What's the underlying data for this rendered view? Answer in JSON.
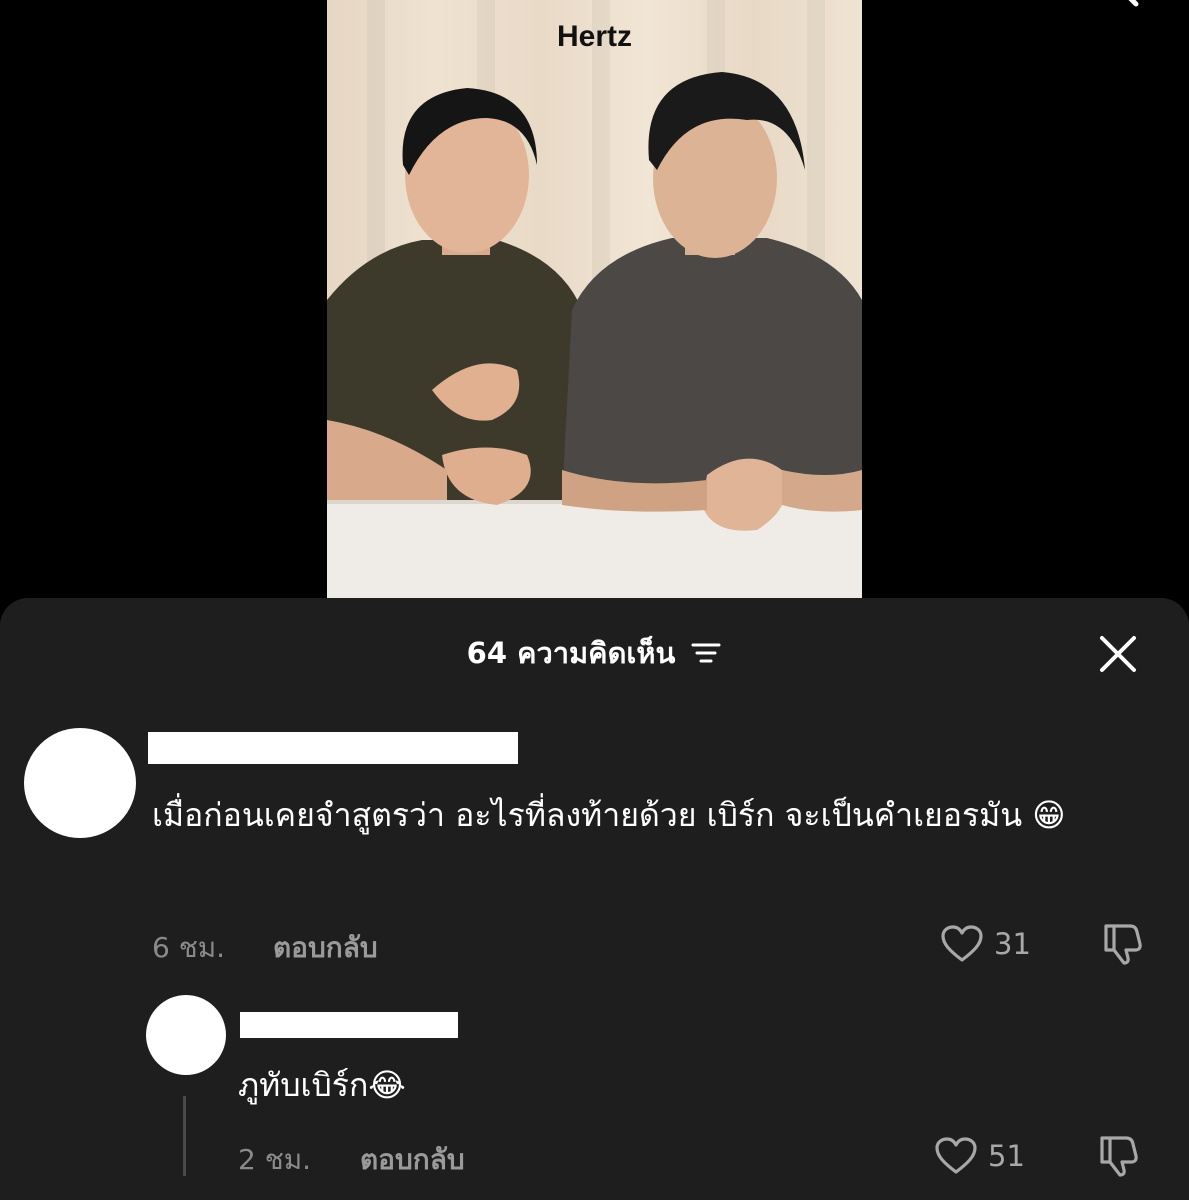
{
  "video": {
    "brand": "Hertz",
    "icons": {
      "search": "search-icon"
    }
  },
  "comments_sheet": {
    "count_label": "64 ความคิดเห็น",
    "icons": {
      "sort": "sort-icon",
      "close": "close-icon",
      "like": "heart-icon",
      "dislike": "thumbs-down-icon"
    },
    "comments": [
      {
        "text": "เมื่อก่อนเคยจำสูตรว่า อะไรที่ลงท้ายด้วย เบิร์ก จะเป็นคำเยอรมัน 😁",
        "time": "6 ชม.",
        "reply_label": "ตอบกลับ",
        "likes": "31"
      }
    ],
    "replies": [
      {
        "text": "ภูทับเบิร์ก😂",
        "time": "2 ชม.",
        "reply_label": "ตอบกลับ",
        "likes": "51"
      }
    ]
  }
}
